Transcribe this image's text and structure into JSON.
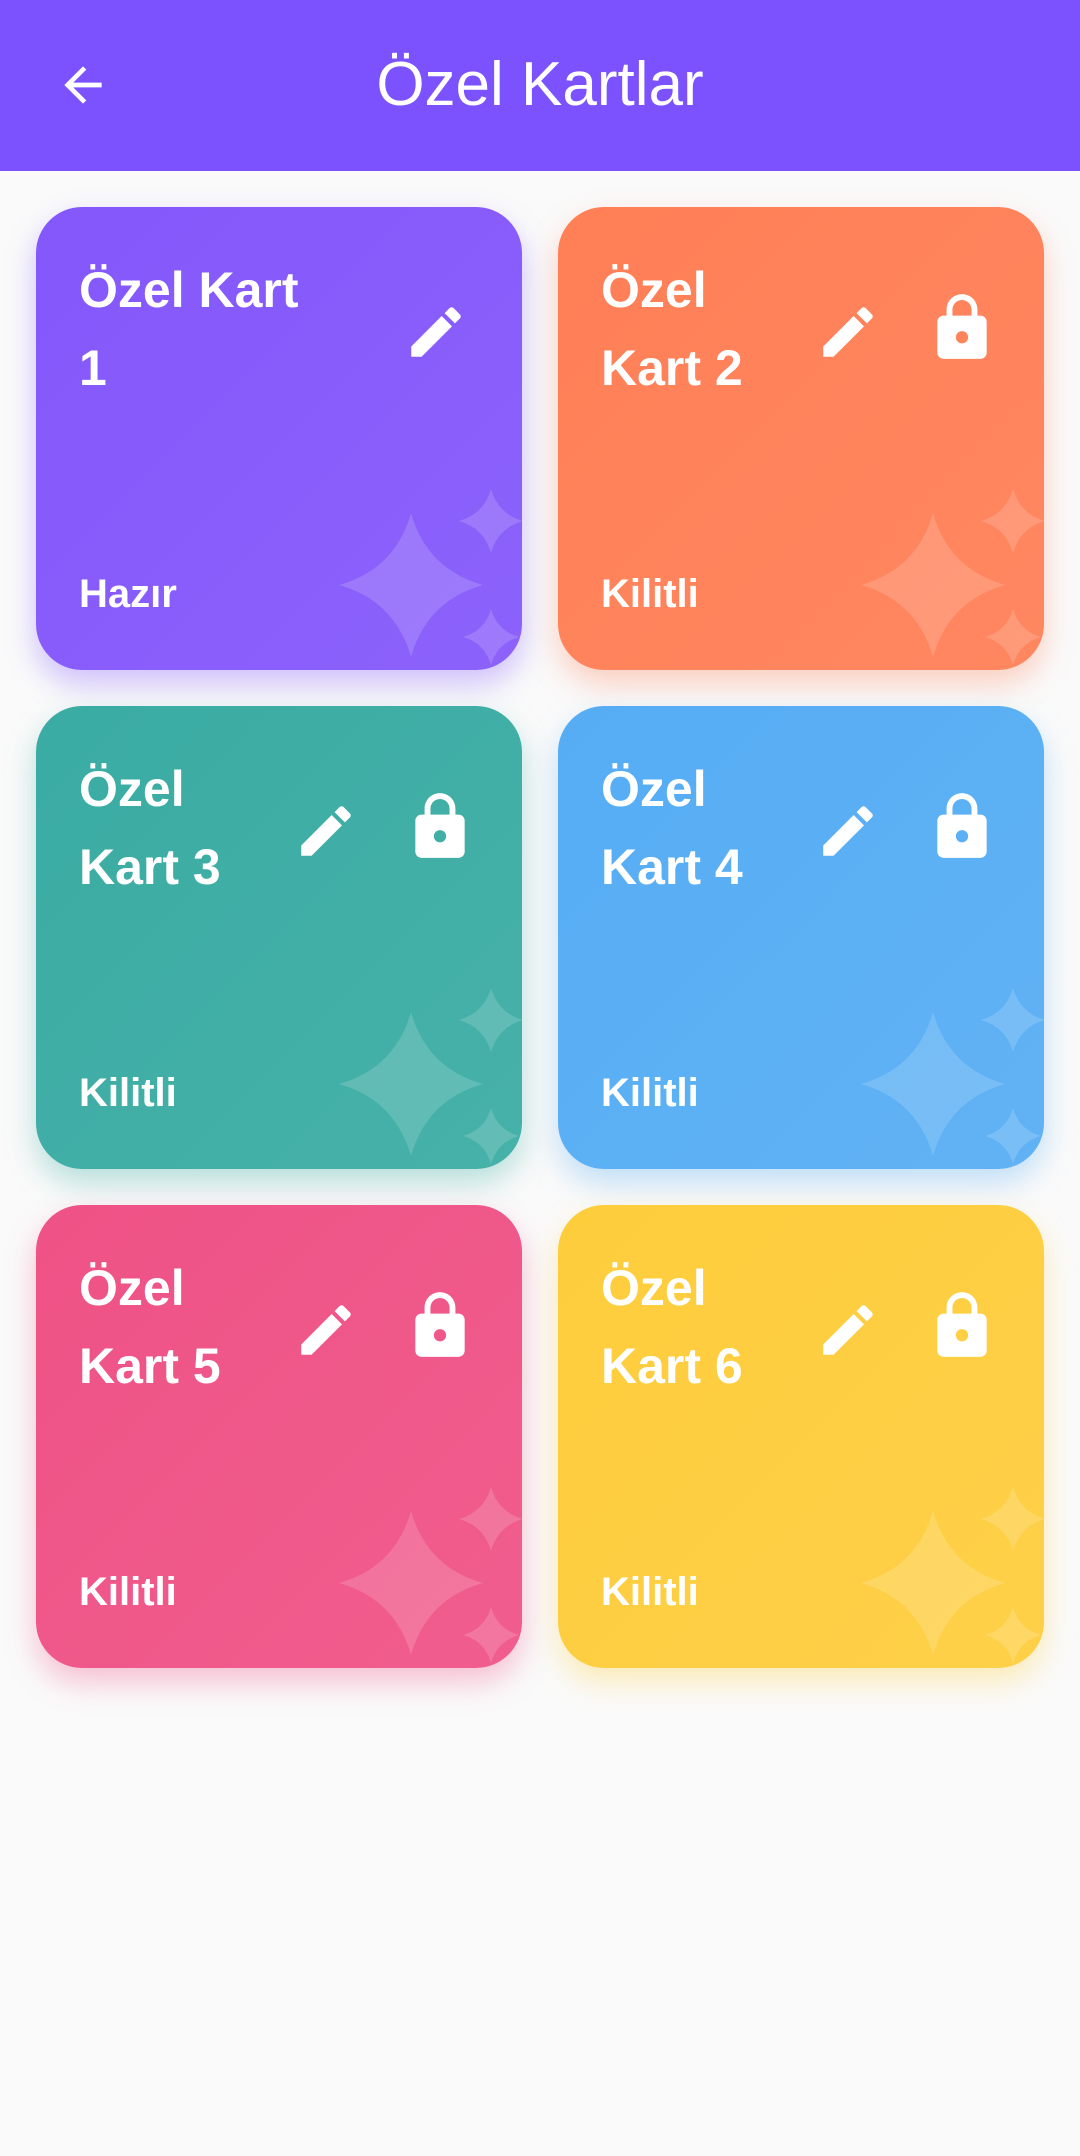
{
  "app_bar": {
    "title": "Özel Kartlar",
    "color": "#7c52ff",
    "back_icon": "arrow-left-icon"
  },
  "cards": [
    {
      "title": "Özel Kart 1",
      "status": "Hazır",
      "locked": false,
      "color": "#8457fb",
      "shadow": "rgba(124,82,255,0.35)"
    },
    {
      "title": "Özel Kart 2",
      "status": "Kilitli",
      "locked": true,
      "color": "#ff7f56",
      "shadow": "rgba(255,127,86,0.35)"
    },
    {
      "title": "Özel Kart 3",
      "status": "Kilitli",
      "locked": true,
      "color": "#3aaca3",
      "shadow": "rgba(58,172,163,0.35)"
    },
    {
      "title": "Özel Kart 4",
      "status": "Kilitli",
      "locked": true,
      "color": "#56adf4",
      "shadow": "rgba(86,173,244,0.35)"
    },
    {
      "title": "Özel Kart 5",
      "status": "Kilitli",
      "locked": true,
      "color": "#ef5286",
      "shadow": "rgba(239,82,134,0.35)"
    },
    {
      "title": "Özel Kart 6",
      "status": "Kilitli",
      "locked": true,
      "color": "#fecd3c",
      "shadow": "rgba(254,205,60,0.35)"
    }
  ],
  "icons": {
    "edit": "pencil-icon",
    "lock": "lock-icon",
    "decor": "sparkle-icon"
  }
}
